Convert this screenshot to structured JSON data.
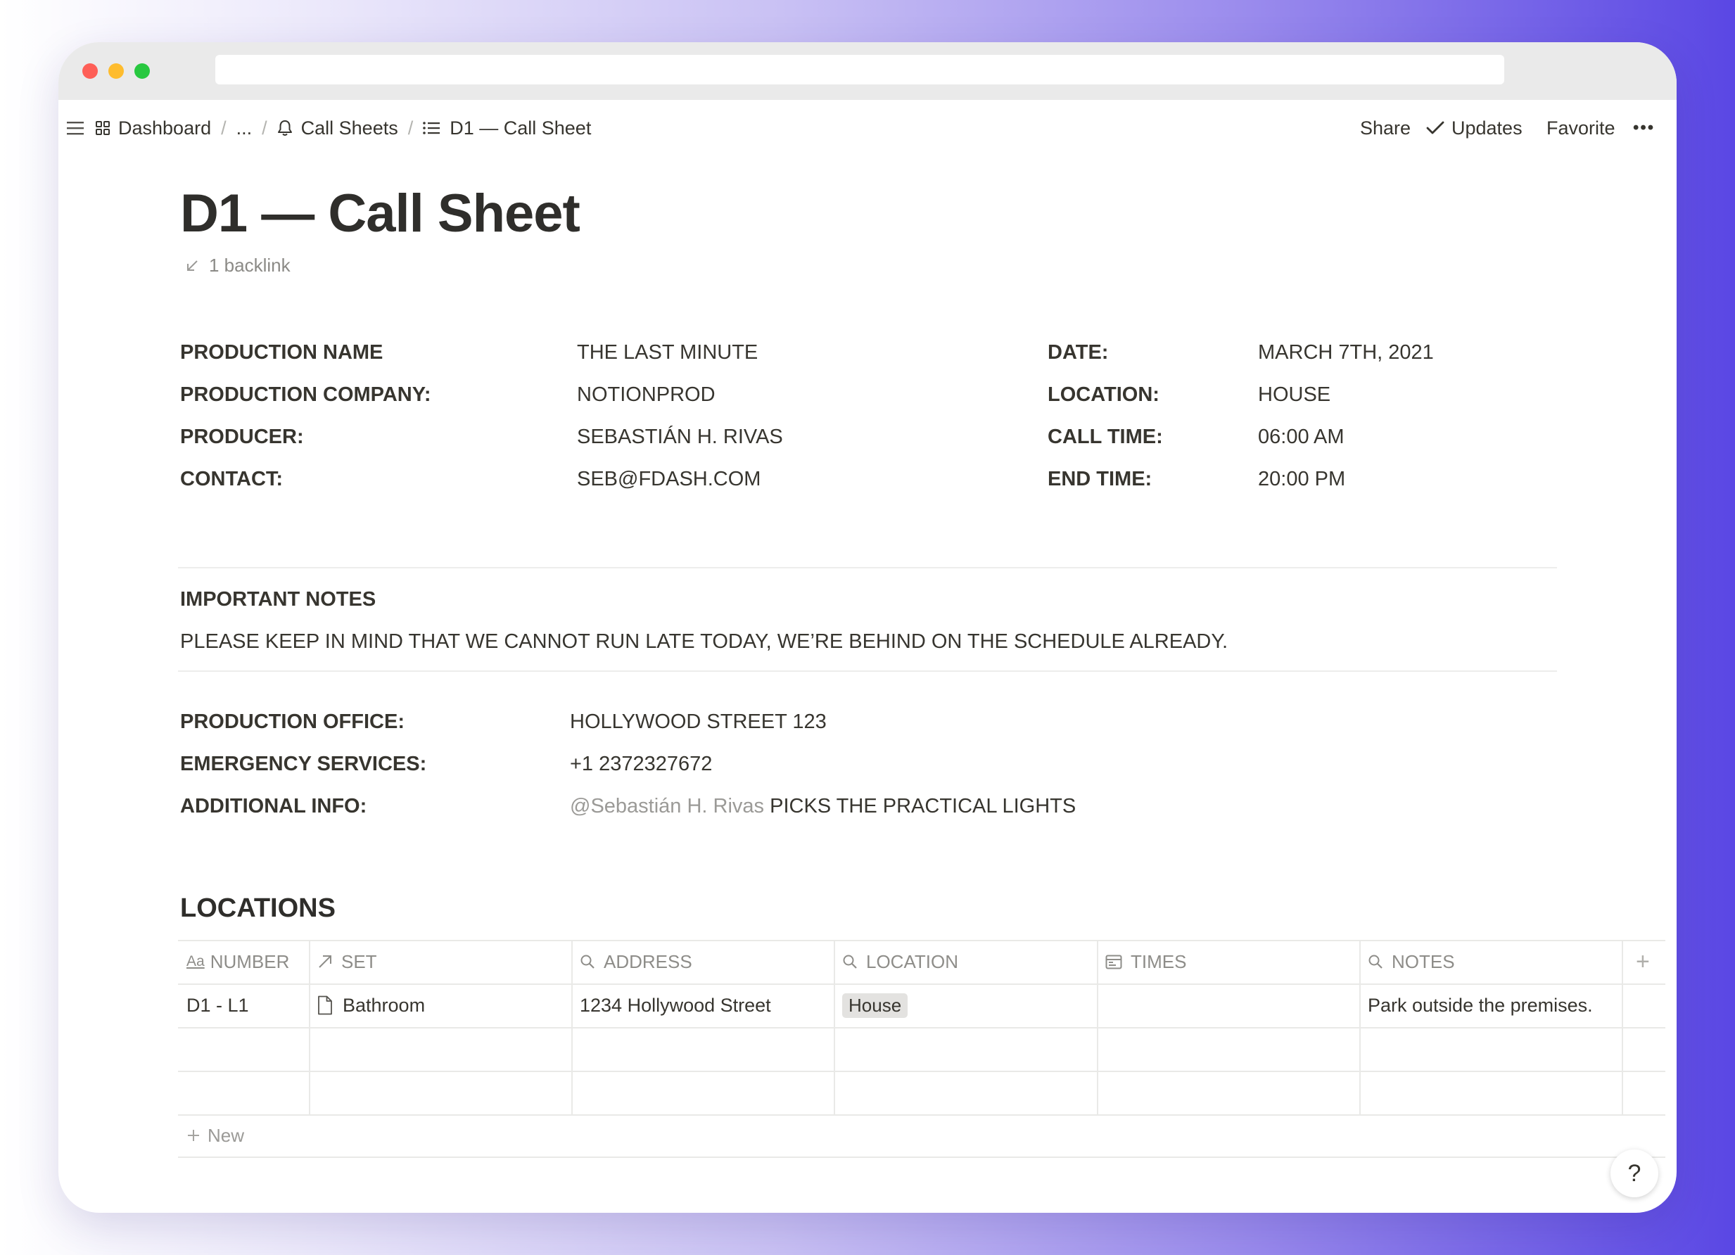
{
  "breadcrumb": {
    "dashboard": "Dashboard",
    "ellipsis": "...",
    "call_sheets": "Call Sheets",
    "current": "D1 — Call Sheet",
    "separator": "/"
  },
  "topbar_actions": {
    "share": "Share",
    "updates": "Updates",
    "favorite": "Favorite",
    "more": "•••"
  },
  "page": {
    "title": "D1 — Call Sheet",
    "backlinks": "1 backlink"
  },
  "production": {
    "name_label": "PRODUCTION NAME",
    "name_value": "THE LAST MINUTE",
    "company_label": "PRODUCTION COMPANY:",
    "company_value": "NOTIONPROD",
    "producer_label": "PRODUCER:",
    "producer_value": "SEBASTIÁN H. RIVAS",
    "contact_label": "CONTACT:",
    "contact_value": "SEB@FDASH.COM",
    "date_label": "DATE:",
    "date_value": "MARCH 7TH, 2021",
    "location_label": "LOCATION:",
    "location_value": "HOUSE",
    "call_time_label": "CALL TIME:",
    "call_time_value": "06:00 AM",
    "end_time_label": "END TIME:",
    "end_time_value": "20:00 PM"
  },
  "notes": {
    "heading": "IMPORTANT NOTES",
    "body": "PLEASE KEEP IN MIND THAT WE CANNOT RUN LATE TODAY, WE’RE BEHIND ON THE SCHEDULE ALREADY."
  },
  "office": {
    "office_label": "PRODUCTION OFFICE:",
    "office_value": "HOLLYWOOD STREET 123",
    "emergency_label": "EMERGENCY SERVICES:",
    "emergency_value": "+1 2372327672",
    "additional_label": "ADDITIONAL INFO:",
    "additional_mention": "@Sebastián H. Rivas",
    "additional_value": "PICKS THE PRACTICAL LIGHTS"
  },
  "locations": {
    "heading": "LOCATIONS",
    "columns": [
      "NUMBER",
      "SET",
      "ADDRESS",
      "LOCATION",
      "TIMES",
      "NOTES"
    ],
    "add_column": "+",
    "rows": [
      {
        "number": "D1 - L1",
        "set": "Bathroom",
        "address": "1234 Hollywood Street",
        "location": "House",
        "times": "",
        "notes": "Park outside the premises."
      }
    ],
    "new_label": "New"
  },
  "help": "?"
}
